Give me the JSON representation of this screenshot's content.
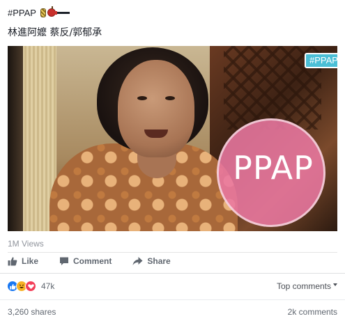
{
  "post": {
    "hashtag": "#PPAP",
    "caption": "林進阿嬤 蔡反/郭郁承"
  },
  "video": {
    "badge": "#PPAP",
    "sticker_text": "PPAP",
    "sticker_color": "#e978a0"
  },
  "stats": {
    "views": "1M Views"
  },
  "actions": [
    {
      "label": "Like",
      "icon": "thumbs-up-icon"
    },
    {
      "label": "Comment",
      "icon": "comment-icon"
    },
    {
      "label": "Share",
      "icon": "share-arrow-icon"
    }
  ],
  "reactions": {
    "icons": [
      "like-reaction-icon",
      "haha-reaction-icon",
      "love-reaction-icon"
    ],
    "count": "47k"
  },
  "comments_sort": {
    "label": "Top comments"
  },
  "footer": {
    "shares": "3,260 shares",
    "comments": "2k comments"
  },
  "colors": {
    "like_blue": "#1877f2",
    "haha_yellow": "#f7b125",
    "love_red": "#f33e58",
    "badge_cyan": "#4bbfd6"
  }
}
